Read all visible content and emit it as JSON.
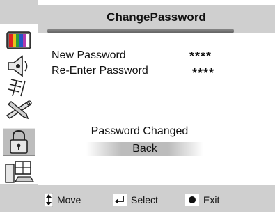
{
  "menu": {
    "title": "ChangePassword"
  },
  "sidebar": {
    "icons": [
      {
        "name": "picture-icon"
      },
      {
        "name": "sound-icon"
      },
      {
        "name": "antenna-icon"
      },
      {
        "name": "tools-icon"
      },
      {
        "name": "lock-icon",
        "selected": true
      },
      {
        "name": "pc-setup-icon"
      }
    ]
  },
  "fields": {
    "new_password": {
      "label": "New Password",
      "value": "****"
    },
    "reenter_password": {
      "label": "Re-Enter Password",
      "value": "****"
    }
  },
  "status": {
    "text": "Password Changed",
    "back_label": "Back"
  },
  "footer": {
    "move_label": "Move",
    "select_label": "Select",
    "exit_label": "Exit"
  }
}
